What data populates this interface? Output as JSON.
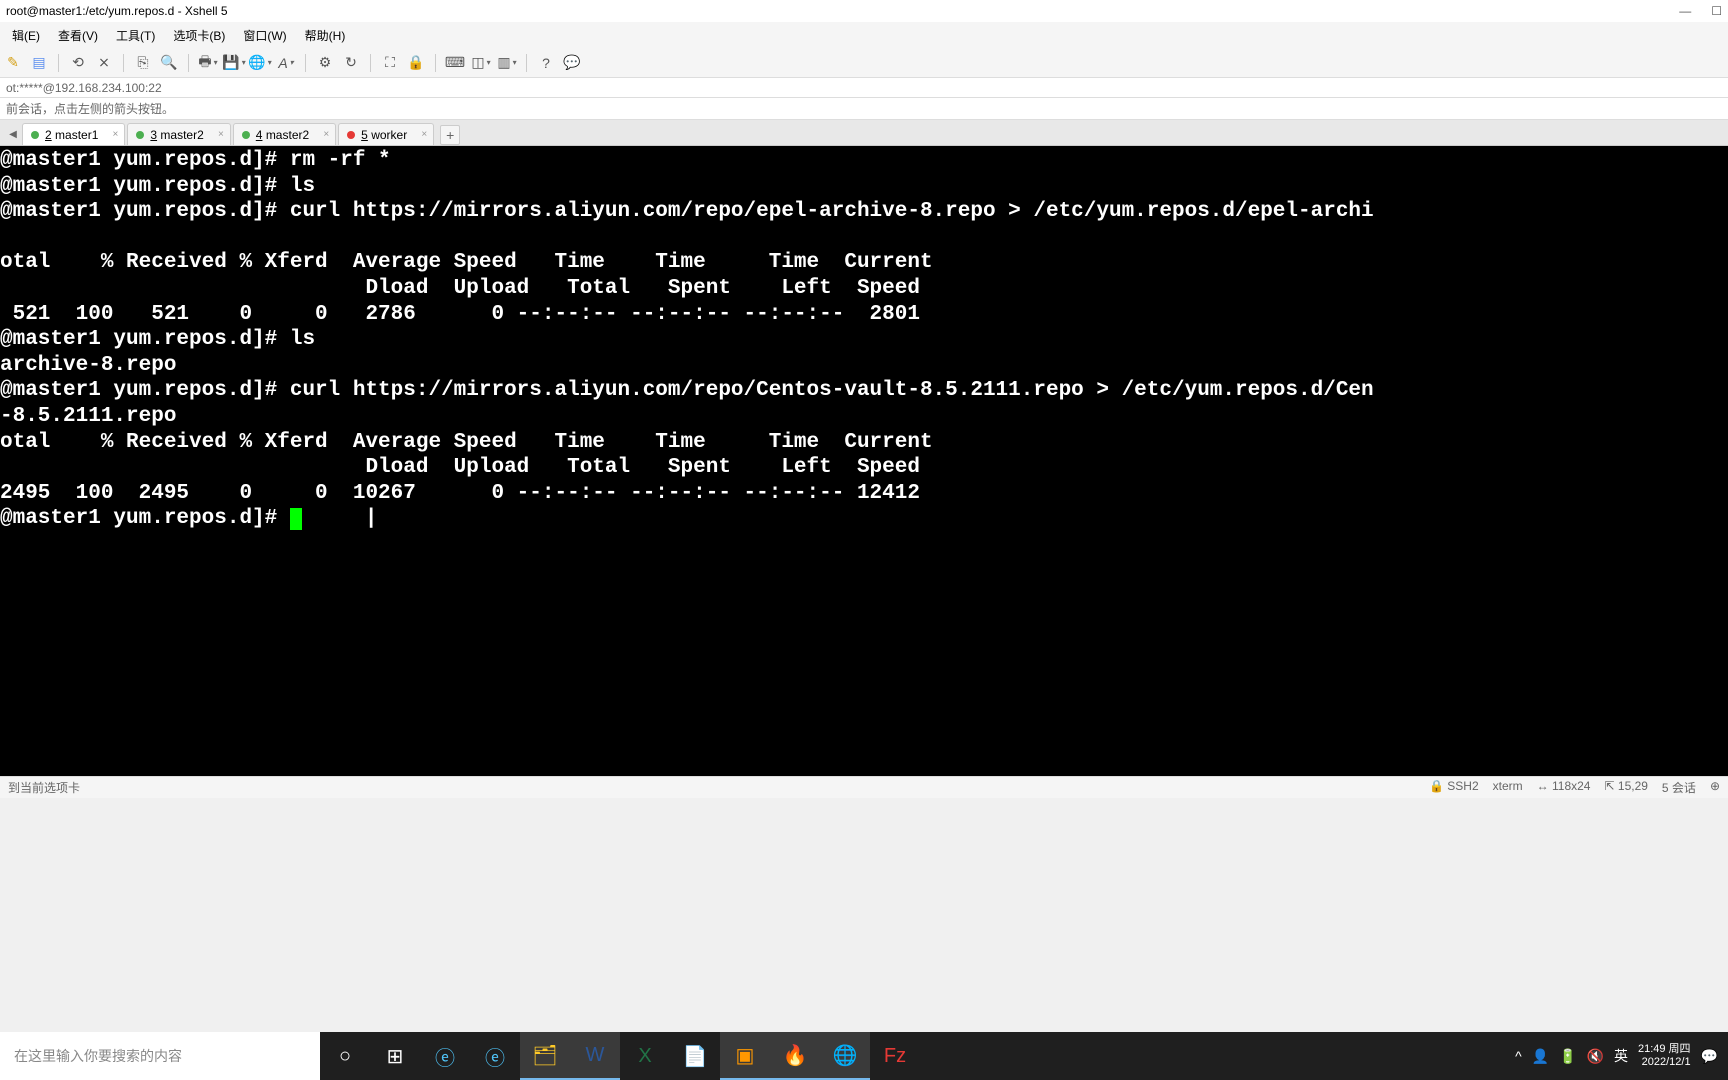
{
  "window": {
    "title": "root@master1:/etc/yum.repos.d - Xshell 5"
  },
  "menu": {
    "items": [
      "辑(E)",
      "查看(V)",
      "工具(T)",
      "选项卡(B)",
      "窗口(W)",
      "帮助(H)"
    ]
  },
  "address": "ot:*****@192.168.234.100:22",
  "hint": "前会话，点击左侧的箭头按钮。",
  "tabs": [
    {
      "num": "2",
      "label": "master1",
      "active": true,
      "dot": "green"
    },
    {
      "num": "3",
      "label": "master2",
      "active": false,
      "dot": "green"
    },
    {
      "num": "4",
      "label": "master2",
      "active": false,
      "dot": "green"
    },
    {
      "num": "5",
      "label": "worker",
      "active": false,
      "dot": "red"
    }
  ],
  "terminal_lines": [
    "@master1 yum.repos.d]# rm -rf *",
    "@master1 yum.repos.d]# ls",
    "@master1 yum.repos.d]# curl https://mirrors.aliyun.com/repo/epel-archive-8.repo > /etc/yum.repos.d/epel-archi",
    "",
    "otal    % Received % Xferd  Average Speed   Time    Time     Time  Current",
    "                             Dload  Upload   Total   Spent    Left  Speed",
    " 521  100   521    0     0   2786      0 --:--:-- --:--:-- --:--:--  2801",
    "@master1 yum.repos.d]# ls",
    "archive-8.repo",
    "@master1 yum.repos.d]# curl https://mirrors.aliyun.com/repo/Centos-vault-8.5.2111.repo > /etc/yum.repos.d/Cen",
    "-8.5.2111.repo",
    "otal    % Received % Xferd  Average Speed   Time    Time     Time  Current",
    "                             Dload  Upload   Total   Spent    Left  Speed",
    "2495  100  2495    0     0  10267      0 --:--:-- --:--:-- --:--:-- 12412",
    "@master1 yum.repos.d]# "
  ],
  "status": {
    "left": "到当前选项卡",
    "ssh_icon": "🔒",
    "ssh": "SSH2",
    "term": "xterm",
    "size_icon": "↔",
    "size": "118x24",
    "pos_icon": "⇱",
    "pos": "15,29",
    "sessions": "5 会话",
    "cap_icon": "⊕"
  },
  "taskbar": {
    "search_placeholder": "在这里输入你要搜索的内容",
    "clock_time": "21:49 周四",
    "clock_date": "2022/12/1",
    "ime": "英"
  }
}
